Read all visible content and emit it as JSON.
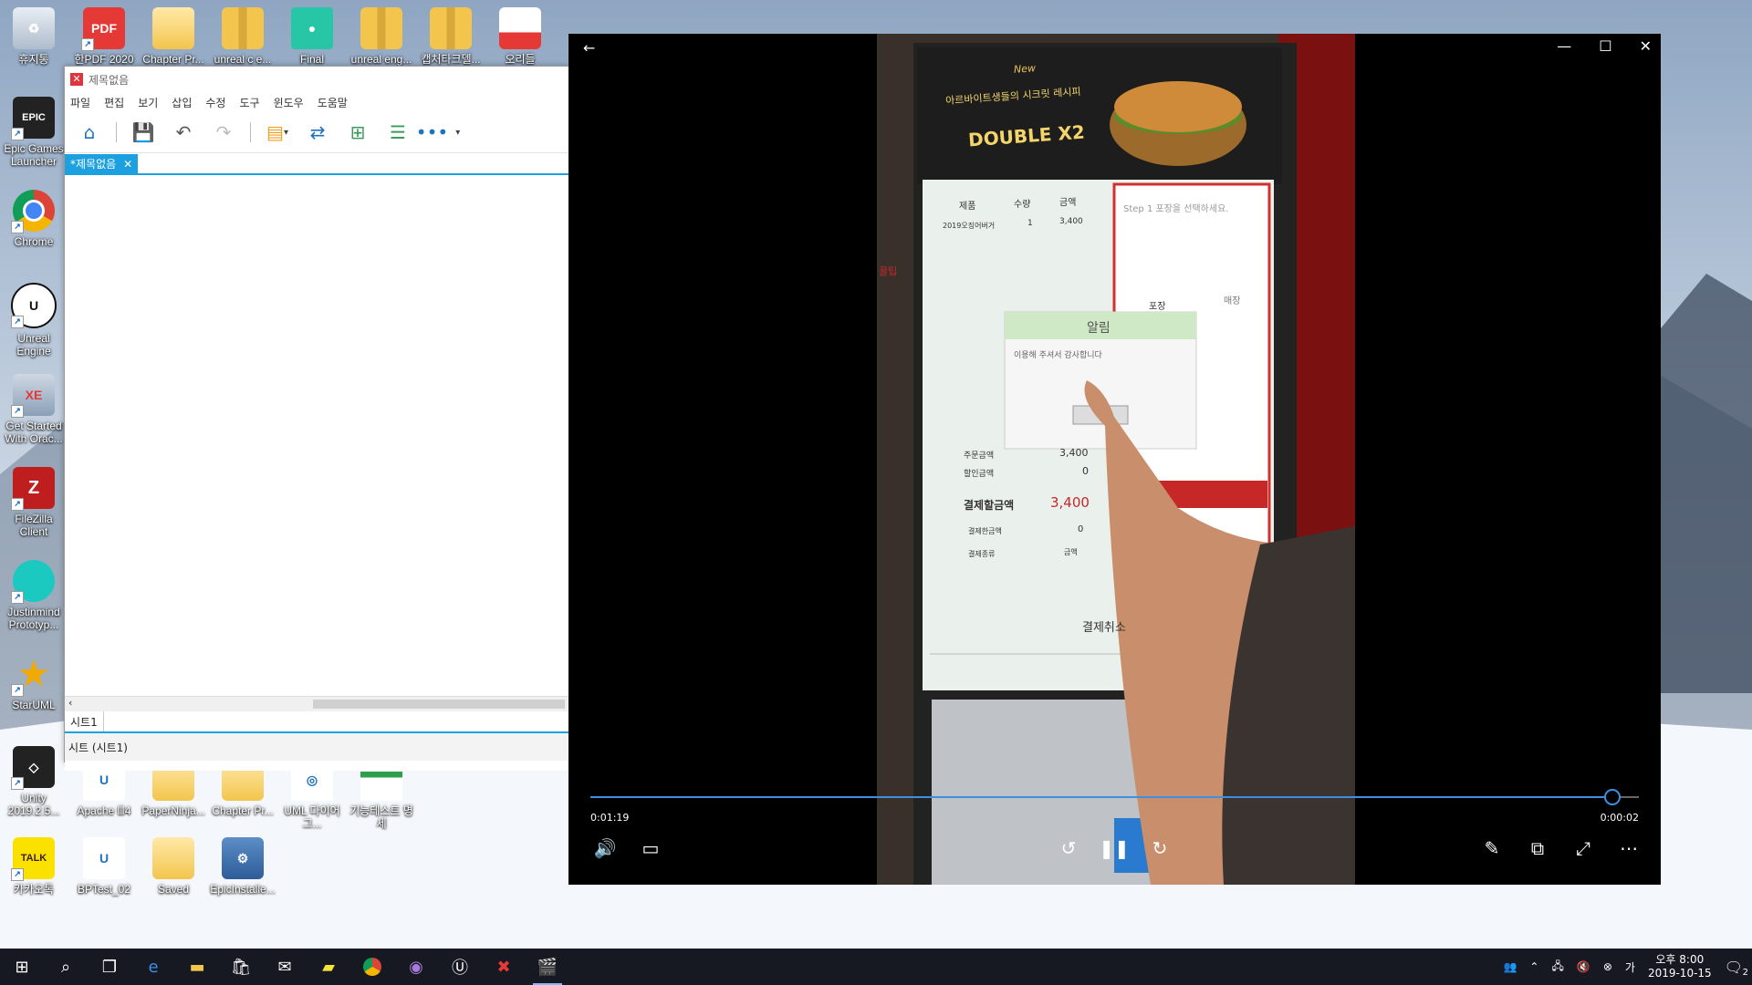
{
  "desktop": {
    "icons": [
      {
        "label": "휴지통",
        "icon": "recycle-bin-icon"
      },
      {
        "label": "한PDF 2020",
        "icon": "hanpdf-icon"
      },
      {
        "label": "Chapter Pr...",
        "icon": "folder-icon"
      },
      {
        "label": "unreal c e...",
        "icon": "zip-folder-icon"
      },
      {
        "label": "Final",
        "icon": "file-icon"
      },
      {
        "label": "unreal eng...",
        "icon": "zip-folder-icon"
      },
      {
        "label": "캡처타크델...",
        "icon": "zip-folder-icon"
      },
      {
        "label": "오리들",
        "icon": "file-icon"
      },
      {
        "label": "Epic Games Launcher",
        "icon": "epic-games-icon"
      },
      {
        "label": "Chrome",
        "icon": "chrome-icon"
      },
      {
        "label": "Unreal Engine",
        "icon": "unreal-engine-icon"
      },
      {
        "label": "Get Started With Orac...",
        "icon": "oracle-xe-icon"
      },
      {
        "label": "FileZilla Client",
        "icon": "filezilla-icon"
      },
      {
        "label": "Justinmind Prototyp...",
        "icon": "justinmind-icon"
      },
      {
        "label": "StarUML",
        "icon": "staruml-icon"
      },
      {
        "label": "Unity 2019.2.5...",
        "icon": "unity-icon"
      },
      {
        "label": "Apache Ⅲ4",
        "icon": "unreal-project-icon"
      },
      {
        "label": "PaperNinja...",
        "icon": "folder-icon"
      },
      {
        "label": "Chapter Pr...",
        "icon": "folder-icon"
      },
      {
        "label": "UML 다이어그...",
        "icon": "document-icon"
      },
      {
        "label": "기능테스트 명세",
        "icon": "spreadsheet-icon"
      },
      {
        "label": "카카오톡",
        "icon": "kakaotalk-icon"
      },
      {
        "label": "BPTest_02",
        "icon": "unreal-project-icon"
      },
      {
        "label": "Saved",
        "icon": "folder-icon"
      },
      {
        "label": "EpicInstalle...",
        "icon": "installer-icon"
      }
    ]
  },
  "editor": {
    "title": "제목없음",
    "menu": [
      "파일",
      "편집",
      "보기",
      "삽입",
      "수정",
      "도구",
      "윈도우",
      "도움말"
    ],
    "tab_label": "*제목없음",
    "sheet_label": "시트1",
    "status_text": "시트 (시트1)"
  },
  "player": {
    "elapsed": "0:01:19",
    "remaining": "0:00:02",
    "progress": 0.975,
    "video_text": {
      "banner_new": "New",
      "banner_sub": "아르바이트생들의 시크릿 레시피",
      "banner_title": "DOUBLE X2",
      "col_product": "제품",
      "col_qty": "수량",
      "col_price": "금액",
      "row_product": "2019오징어버거",
      "row_qty": "1",
      "row_price": "3,400",
      "step": "Step 1 포장을 선택하세요.",
      "opt_takeout": "포장",
      "opt_dinein": "매장",
      "dialog_title": "알림",
      "dialog_msg": "이용해 주셔서 감사합니다",
      "order_amount_label": "주문금액",
      "order_amount": "3,400",
      "discount_label": "할인금액",
      "discount": "0",
      "pay_label": "결제할금액",
      "pay_amount": "3,400",
      "paid_label": "결제한금액",
      "paid": "0",
      "pay_type_label": "결제종류",
      "pay_type": "금액",
      "cancel": "결제취소",
      "side_title": "꿀팁"
    }
  },
  "taskbar": {
    "time": "오후 8:00",
    "date": "2019-10-15",
    "notifications": "2"
  }
}
